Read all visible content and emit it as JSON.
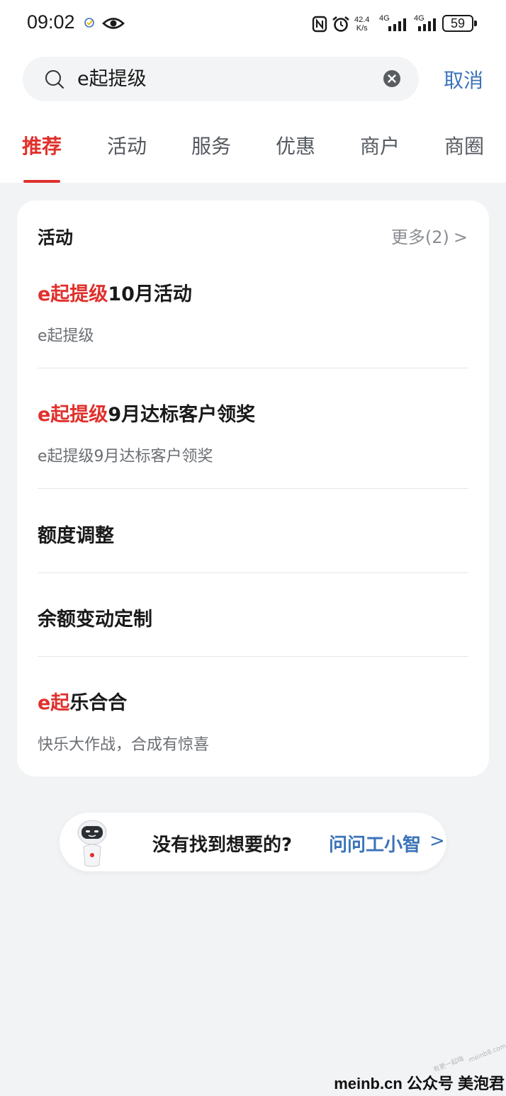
{
  "status_bar": {
    "time": "09:02",
    "net_speed_value": "42.4",
    "net_speed_unit": "K/s",
    "signal1_label": "4G",
    "signal2_label": "4G",
    "battery": "59"
  },
  "search": {
    "value": "e起提级",
    "cancel_label": "取消"
  },
  "tabs": [
    {
      "label": "推荐",
      "active": true
    },
    {
      "label": "活动"
    },
    {
      "label": "服务"
    },
    {
      "label": "优惠"
    },
    {
      "label": "商户"
    },
    {
      "label": "商圈"
    }
  ],
  "section": {
    "title": "活动",
    "more_label": "更多(2)",
    "items": [
      {
        "highlight": "e起提级",
        "rest": "10月活动",
        "subtitle": "e起提级"
      },
      {
        "highlight": "e起提级",
        "rest": "9月达标客户领奖",
        "subtitle": "e起提级9月达标客户领奖"
      },
      {
        "highlight": "",
        "rest": "额度调整",
        "subtitle": ""
      },
      {
        "highlight": "",
        "rest": "余额变动定制",
        "subtitle": ""
      },
      {
        "highlight": "e起",
        "rest": "乐合合",
        "subtitle": "快乐大作战，合成有惊喜"
      }
    ]
  },
  "help": {
    "question": "没有找到想要的?",
    "link_label": "问问工小智"
  },
  "watermark": {
    "text": "meinb.cn  公众号 美泡君",
    "tilted_text_1": "有更一起嗨",
    "tilted_text_2": "meinb8.com"
  },
  "colors": {
    "accent_red": "#e0302b",
    "link_blue": "#3b73b9",
    "page_bg": "#f2f3f5"
  }
}
